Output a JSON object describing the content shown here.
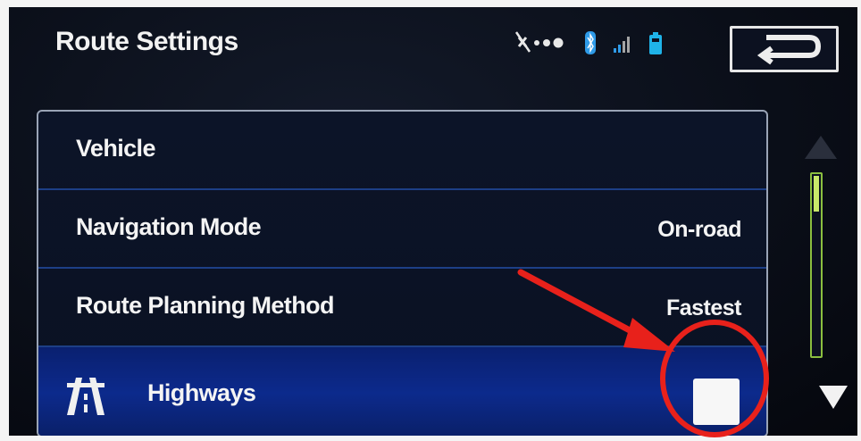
{
  "header": {
    "title": "Route Settings"
  },
  "status_icons": [
    "mute-icon",
    "ellipsis-icon",
    "bluetooth-icon",
    "signal-icon",
    "battery-icon"
  ],
  "back_button_icon": "back-arrow-icon",
  "settings": {
    "rows": [
      {
        "label": "Vehicle",
        "value": ""
      },
      {
        "label": "Navigation Mode",
        "value": "On-road"
      },
      {
        "label": "Route Planning Method",
        "value": "Fastest"
      },
      {
        "label": "Highways",
        "icon": "highway-icon",
        "checked": false
      }
    ]
  },
  "scrollbar": {
    "position": 0.0
  },
  "colors": {
    "bluetooth": "#2f9be8",
    "battery": "#1fb3e8",
    "scroll_accent": "#8bbf3f",
    "selected_row": "#0b2580",
    "annotation": "#e8211b"
  }
}
